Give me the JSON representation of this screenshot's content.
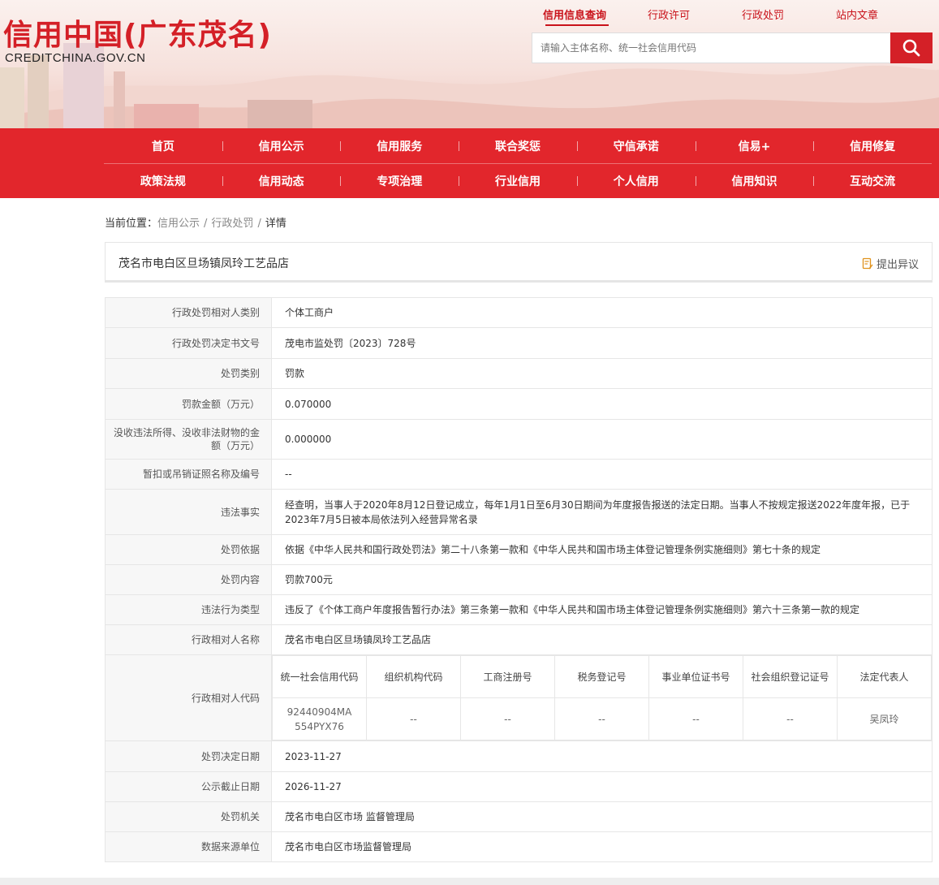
{
  "header": {
    "logo_title": "信用中国(广东茂名)",
    "logo_sub": "CREDITCHINA.GOV.CN",
    "top_nav": [
      "信用信息查询",
      "行政许可",
      "行政处罚",
      "站内文章"
    ],
    "search_placeholder": "请输入主体名称、统一社会信用代码"
  },
  "main_nav": {
    "row1": [
      "首页",
      "信用公示",
      "信用服务",
      "联合奖惩",
      "守信承诺",
      "信易+",
      "信用修复"
    ],
    "row2": [
      "政策法规",
      "信用动态",
      "专项治理",
      "行业信用",
      "个人信用",
      "信用知识",
      "互动交流"
    ]
  },
  "breadcrumb": {
    "prefix": "当前位置：",
    "items": [
      "信用公示",
      "行政处罚",
      "详情"
    ]
  },
  "title_bar": {
    "name": "茂名市电白区旦场镇凤玲工艺品店",
    "objection": "提出异议"
  },
  "detail": {
    "rows_top": [
      {
        "label": "行政处罚相对人类别",
        "value": "个体工商户"
      },
      {
        "label": "行政处罚决定书文号",
        "value": "茂电市监处罚〔2023〕728号"
      },
      {
        "label": "处罚类别",
        "value": "罚款"
      },
      {
        "label": "罚款金额（万元）",
        "value": "0.070000"
      },
      {
        "label": "没收违法所得、没收非法财物的金额（万元）",
        "value": "0.000000"
      },
      {
        "label": "暂扣或吊销证照名称及编号",
        "value": "--"
      },
      {
        "label": "违法事实",
        "value": "经查明，当事人于2020年8月12日登记成立，每年1月1日至6月30日期间为年度报告报送的法定日期。当事人不按规定报送2022年度年报，已于2023年7月5日被本局依法列入经营异常名录"
      },
      {
        "label": "处罚依据",
        "value": "依据《中华人民共和国行政处罚法》第二十八条第一款和《中华人民共和国市场主体登记管理条例实施细则》第七十条的规定"
      },
      {
        "label": "处罚内容",
        "value": "罚款700元"
      },
      {
        "label": "违法行为类型",
        "value": "违反了《个体工商户年度报告暂行办法》第三条第一款和《中华人民共和国市场主体登记管理条例实施细则》第六十三条第一款的规定"
      },
      {
        "label": "行政相对人名称",
        "value": "茂名市电白区旦场镇凤玲工艺品店"
      }
    ],
    "codes": {
      "label": "行政相对人代码",
      "headers": [
        "统一社会信用代码",
        "组织机构代码",
        "工商注册号",
        "税务登记号",
        "事业单位证书号",
        "社会组织登记证号",
        "法定代表人"
      ],
      "values": [
        "92440904MA554PYX76",
        "--",
        "--",
        "--",
        "--",
        "--",
        "吴凤玲"
      ]
    },
    "rows_bottom": [
      {
        "label": "处罚决定日期",
        "value": "2023-11-27"
      },
      {
        "label": "公示截止日期",
        "value": "2026-11-27"
      },
      {
        "label": "处罚机关",
        "value": "茂名市电白区市场 监督管理局"
      },
      {
        "label": "数据来源单位",
        "value": "茂名市电白区市场监督管理局"
      }
    ]
  },
  "colors": {
    "brand_red": "#e2262c",
    "logo_red": "#d42027"
  }
}
